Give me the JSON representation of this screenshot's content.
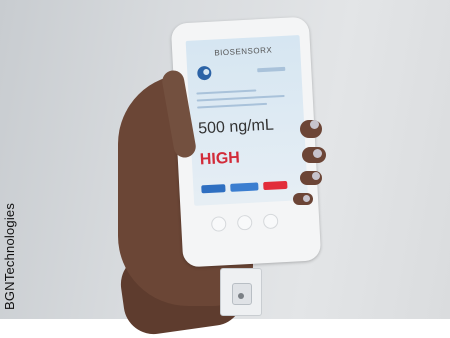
{
  "credit": "BGNTechnologies",
  "app": {
    "brand": "BIOSENSORX",
    "measurement_value": "500 ng/mL",
    "level": "HIGH"
  },
  "colors": {
    "level_text": "#d22b39",
    "button_blue": "#2e6fc1",
    "button_red": "#e22d3a"
  }
}
